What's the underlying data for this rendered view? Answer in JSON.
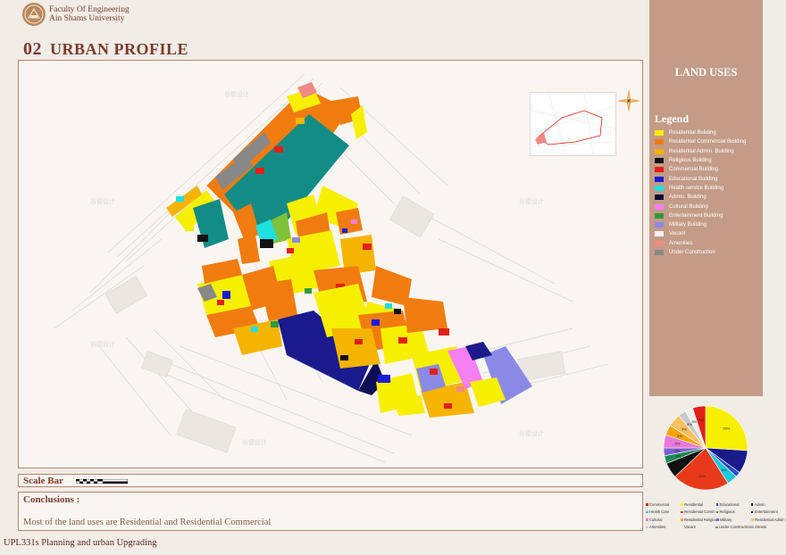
{
  "header": {
    "faculty_line1": "Faculty Of Engineering",
    "faculty_line2": "Ain Shams University",
    "section_number": "02",
    "section_title": "URBAN PROFILE"
  },
  "sidebar": {
    "title": "LAND USES",
    "legend_title": "Legend",
    "legend": [
      {
        "label": "Residential Building",
        "color": "#f7ef00"
      },
      {
        "label": "Residential Commercial Building",
        "color": "#f07c10"
      },
      {
        "label": "Residential Admin. Building",
        "color": "#f5b400"
      },
      {
        "label": "Religious Building",
        "color": "#111111"
      },
      {
        "label": "Commercial Building",
        "color": "#e41e16"
      },
      {
        "label": "Educational Building",
        "color": "#1b1bd6"
      },
      {
        "label": "Health service Building",
        "color": "#1fe0e0"
      },
      {
        "label": "Admin. Building",
        "color": "#0a0a3a"
      },
      {
        "label": "Cultural Building",
        "color": "#f47ff0"
      },
      {
        "label": "Entertainment Building",
        "color": "#2f9a40"
      },
      {
        "label": "Military Building",
        "color": "#8a8ae6"
      },
      {
        "label": "Vacant",
        "color": "#f2f2f2"
      },
      {
        "label": "Amenities",
        "color": "#f08a84"
      },
      {
        "label": "Under Construction",
        "color": "#888888"
      }
    ]
  },
  "pie": {
    "slices": [
      {
        "label": "Residential",
        "value": 26,
        "color": "#f7ef00",
        "text": "26%"
      },
      {
        "label": "Admin",
        "value": 9,
        "color": "#1a1a8c",
        "text": "9%"
      },
      {
        "label": "Educational",
        "value": 2,
        "color": "#2c4bd4",
        "text": "2%"
      },
      {
        "label": "Health Care",
        "value": 4,
        "color": "#1fc8d8",
        "text": "4%"
      },
      {
        "label": "Residential Comm.",
        "value": 22,
        "color": "#e83a1a",
        "text": "22%"
      },
      {
        "label": "Entertainment",
        "value": 6,
        "color": "#111111",
        "text": "6%"
      },
      {
        "label": "Religious",
        "value": 3,
        "color": "#1b8a55",
        "text": "3%"
      },
      {
        "label": "Military",
        "value": 3,
        "color": "#7f5fd0",
        "text": "3%"
      },
      {
        "label": "Cultural",
        "value": 5,
        "color": "#e879d8",
        "text": "5%"
      },
      {
        "label": "Residential Religious",
        "value": 4,
        "color": "#f5a400",
        "text": "4%"
      },
      {
        "label": "Residential Admin",
        "value": 5,
        "color": "#f7c060",
        "text": "5%"
      },
      {
        "label": "Amenities",
        "value": 3,
        "color": "#c8c8c8",
        "text": "3%"
      },
      {
        "label": "Vacant",
        "value": 3,
        "color": "#eeeeee",
        "text": "3%"
      },
      {
        "label": "Commercial",
        "value": 5,
        "color": "#e41e16",
        "text": "5%"
      }
    ],
    "legend": [
      [
        "Commercial",
        "Residential",
        "Educational",
        "Admin"
      ],
      [
        "Health Care",
        "Residential Comm",
        "Religious",
        "Entertainment"
      ],
      [
        "Cultural",
        "Residential Religious",
        "Military",
        "Residential Admin"
      ],
      [
        "Amenities",
        "Vacant",
        "Under Constructions",
        "Streets"
      ]
    ],
    "legend_colors": [
      [
        "#e41e16",
        "#f7ef00",
        "#2c4bd4",
        "#1a1a8c"
      ],
      [
        "#1fc8d8",
        "#e83a1a",
        "#1b8a55",
        "#111111"
      ],
      [
        "#e879d8",
        "#f5a400",
        "#7f5fd0",
        "#f7c060"
      ],
      [
        "#c8c8c8",
        "#eeeeee",
        "#888888",
        "#aaaaaa"
      ]
    ]
  },
  "scale": {
    "label": "Scale Bar"
  },
  "conclusions": {
    "heading": "Conclusions :",
    "text": "Most of the land uses are Residential and Residential Commercial"
  },
  "footer": {
    "course": "UPL331s Planning and urban Upgrading"
  }
}
